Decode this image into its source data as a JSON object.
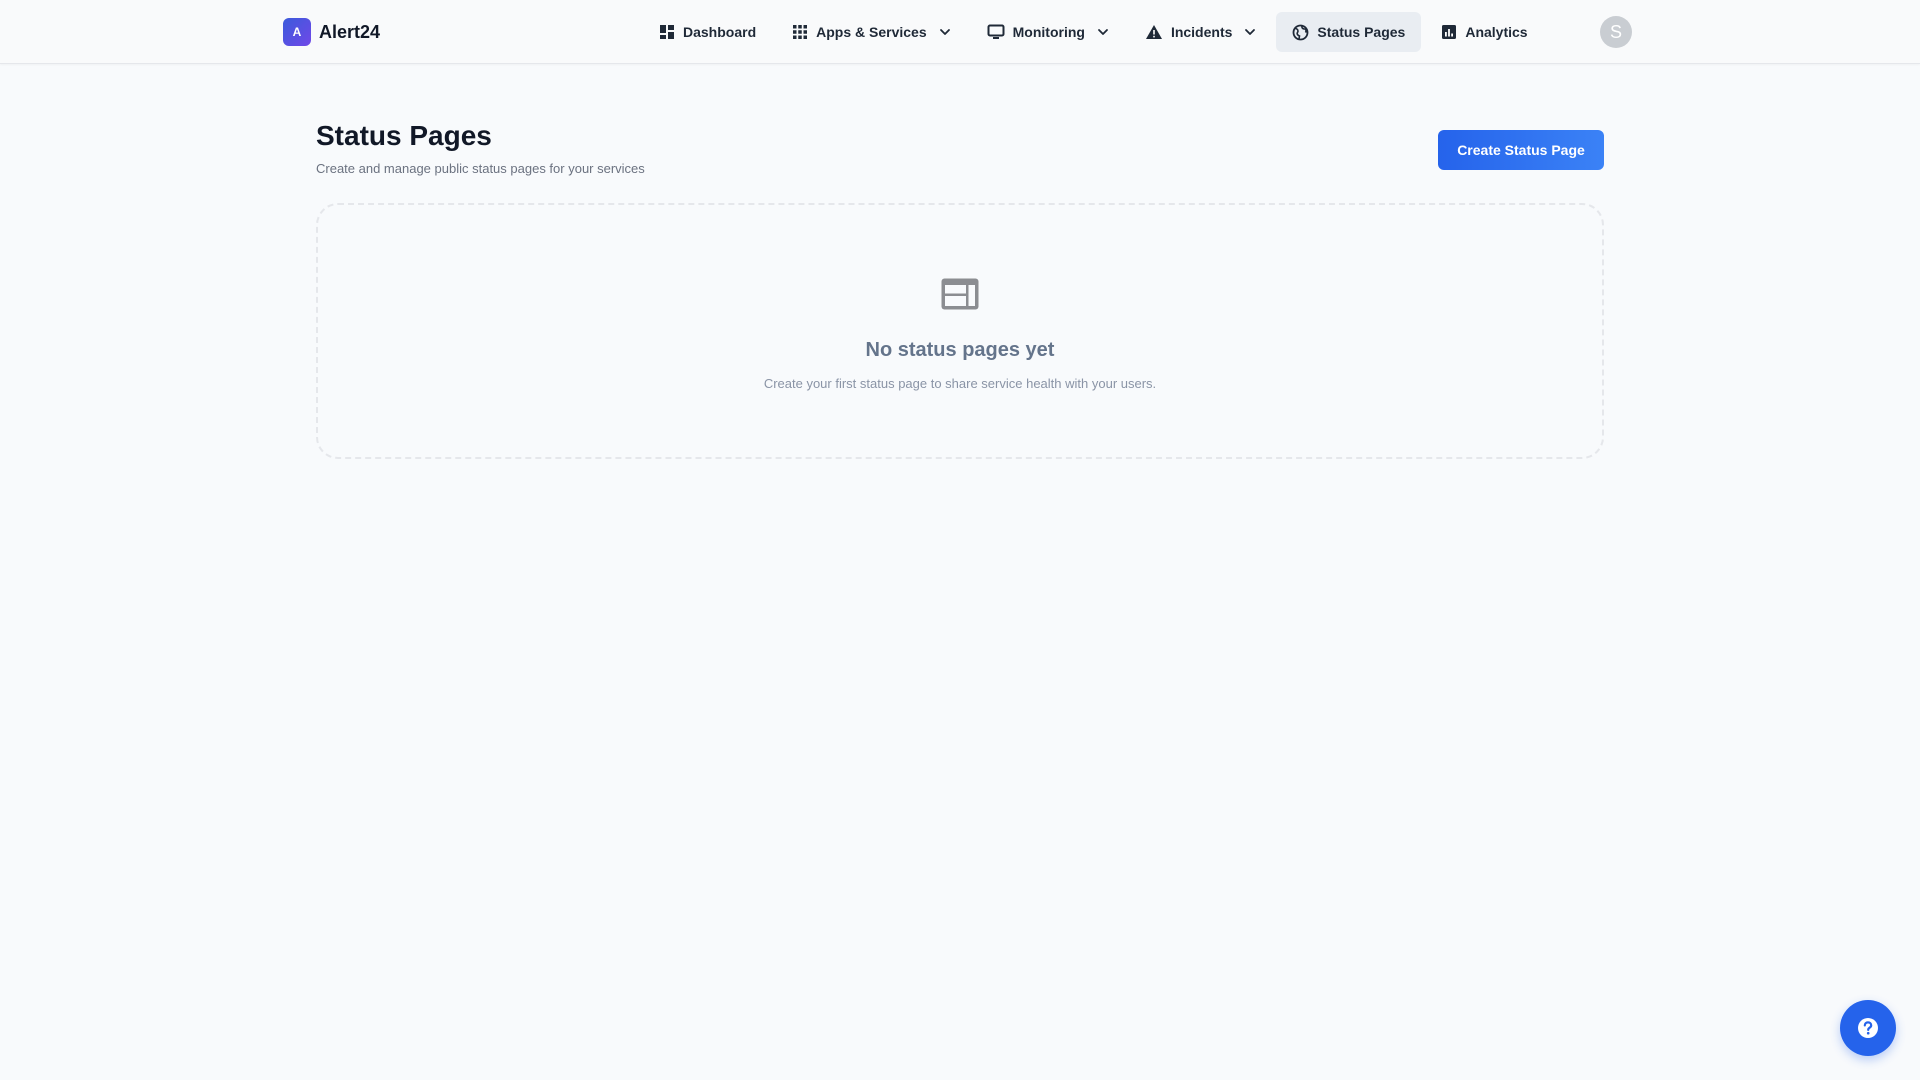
{
  "app": {
    "logo_letter": "A",
    "name": "Alert24"
  },
  "nav": {
    "items": [
      {
        "label": "Dashboard",
        "icon": "dashboard-icon"
      },
      {
        "label": "Apps & Services",
        "icon": "apps-grid-icon",
        "dropdown": true
      },
      {
        "label": "Monitoring",
        "icon": "monitor-icon",
        "dropdown": true
      },
      {
        "label": "Incidents",
        "icon": "warning-icon",
        "dropdown": true
      },
      {
        "label": "Status Pages",
        "icon": "globe-icon",
        "active": true
      },
      {
        "label": "Analytics",
        "icon": "analytics-icon"
      }
    ]
  },
  "user": {
    "avatar_initial": "S"
  },
  "page": {
    "title": "Status Pages",
    "subtitle": "Create and manage public status pages for your services",
    "create_button_label": "Create Status Page"
  },
  "empty_state": {
    "icon": "web-page-icon",
    "title": "No status pages yet",
    "text": "Create your first status page to share service health with your users."
  },
  "help": {
    "icon": "help-icon"
  },
  "colors": {
    "primary": "#2563eb",
    "background": "#f8fafc",
    "active_nav_bg": "#e9edf2",
    "logo_gradient_start": "#3b5bdb",
    "logo_gradient_end": "#7048e8"
  }
}
